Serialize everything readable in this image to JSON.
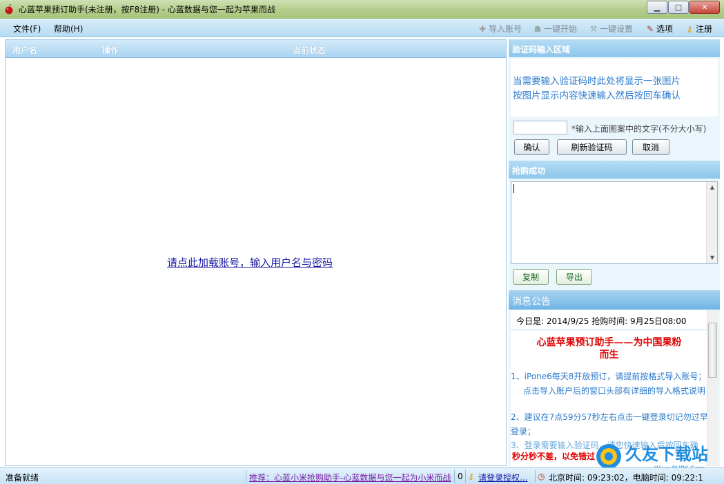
{
  "window": {
    "title": "心蓝苹果预订助手(未注册，按F8注册) - 心蓝数据与您一起为苹果而战",
    "minimize_glyph": "▁",
    "maximize_glyph": "□",
    "close_glyph": "✕"
  },
  "menu": {
    "file": "文件(F)",
    "help": "帮助(H)"
  },
  "toolbar": {
    "import_account": "导入账号",
    "one_click_start": "一键开始",
    "one_click_settings": "一键设置",
    "options": "选项",
    "register": "注册"
  },
  "grid": {
    "columns": [
      "用户名",
      "操作",
      "当前状态"
    ],
    "empty_link": "请点此加载账号，输入用户名与密码"
  },
  "captcha": {
    "header": "验证码输入区域",
    "line1": "当需要输入验证码时此处将显示一张图片",
    "line2": "按图片显示内容快速输入然后按回车确认",
    "input_value": "",
    "hint": "*输入上面图案中的文字(不分大小写)",
    "confirm": "确认",
    "refresh": "刷新验证码",
    "cancel": "取消"
  },
  "success": {
    "header": "抢购成功",
    "log_text": "",
    "copy": "复制",
    "export": "导出"
  },
  "notice": {
    "header": "消息公告",
    "date_line": "今日是: 2014/9/25    抢购时间: 9月25日08:00",
    "title_line1": "心蓝苹果预订助手——为中国果粉",
    "title_line2": "而生",
    "item1_line1": "1、iPone6每天8开放预订，请提前按格式导入账号；",
    "item1_line2": "点击导入账户后的窗口头部有详细的导入格式说明",
    "item2_line1": "2、建议在7点59分57秒左右点击一键登录切记勿过早",
    "item2_line2": "登录；",
    "item3_line1": "3、登录需要输入验证码，请您快速输入后按回车确",
    "red_line": "秒分秒不差，以免错过"
  },
  "status": {
    "ready": "准备就绪",
    "promo": "推荐：心蓝小米抢购助手-心蓝数据与您一起为小米而战",
    "count": "0",
    "login_auth": "请登录授权...",
    "beijing_time": "北京时间: 09:23:02，电脑时间: 09:22:1"
  },
  "watermark": {
    "brand": "久友下载站",
    "site": "Www.9UPK.Com"
  },
  "colors": {
    "accent": "#8cc6ec",
    "notice_text": "#2a79cc",
    "notice_title": "#e00000"
  }
}
